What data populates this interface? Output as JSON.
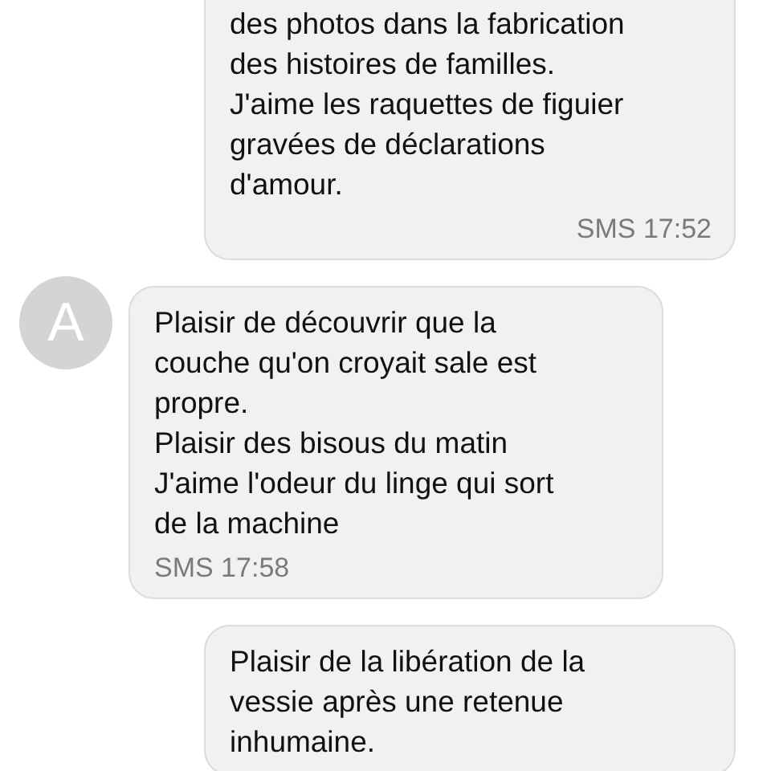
{
  "messages": [
    {
      "kind": "sent",
      "cut_top": true,
      "text": "des photos dans la fabrication\ndes histoires de familles.\nJ'aime les raquettes de figuier\ngravées de déclarations\nd'amour.",
      "meta": "SMS 17:52"
    },
    {
      "kind": "received",
      "avatar": "A",
      "text": "Plaisir de découvrir que la\ncouche qu'on croyait sale est\npropre.\nPlaisir des bisous du matin\nJ'aime l'odeur du linge qui sort\nde la machine",
      "meta": "SMS 17:58"
    },
    {
      "kind": "sent",
      "text": "Plaisir de la libération de la\nvessie après une retenue\ninhumaine."
    }
  ]
}
